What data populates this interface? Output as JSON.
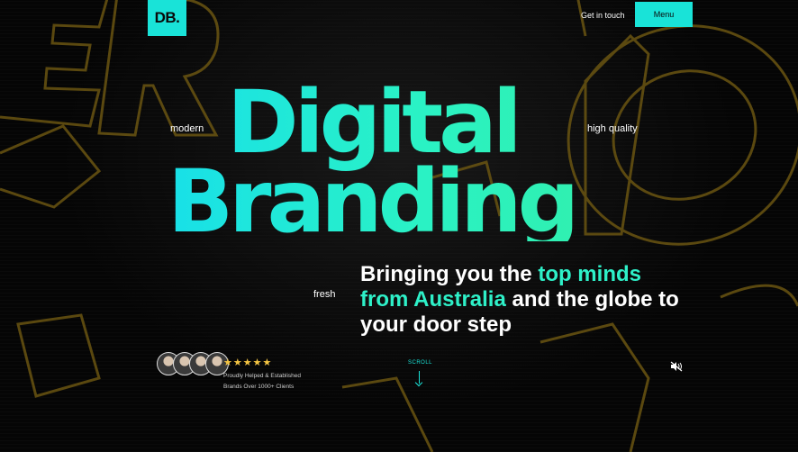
{
  "header": {
    "logo_text": "DB.",
    "get_in_touch": "Get in touch",
    "menu": "Menu"
  },
  "side_words": {
    "modern": "modern",
    "high_quality": "high quality",
    "fresh": "fresh"
  },
  "hero": {
    "title_line1": "Digital",
    "title_line2": "Branding",
    "tagline_part1": "Bringing you the ",
    "tagline_highlight": "top minds from Australia",
    "tagline_part2": " and the globe to your door step"
  },
  "social_proof": {
    "stars": "★★★★★",
    "line1": "Proudly Helped & Established",
    "line2": "Brands Over 1000+ Clients"
  },
  "scroll": {
    "label": "SCROLL"
  },
  "icons": {
    "mute": "speaker-muted-icon",
    "avatars": "client-avatar"
  },
  "colors": {
    "accent": "#19e3d8",
    "gold_outline": "#6b5512",
    "background": "#050505"
  }
}
